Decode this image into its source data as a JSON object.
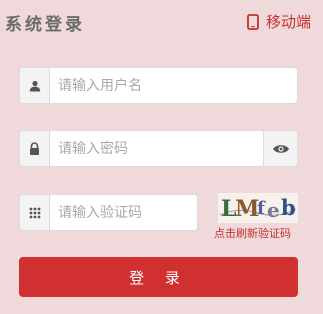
{
  "header": {
    "title": "系统登录",
    "mobile_link": "移动端"
  },
  "form": {
    "username_placeholder": "请输入用户名",
    "password_placeholder": "请输入密码",
    "captcha_placeholder": "请输入验证码",
    "captcha_text": "LMfeb",
    "captcha_refresh": "点击刷新验证码",
    "login_label": "登 录"
  },
  "colors": {
    "accent": "#d0302f",
    "background": "#efd9db"
  },
  "icons": [
    "phone-icon",
    "user-icon",
    "lock-icon",
    "eye-icon",
    "keypad-icon"
  ]
}
